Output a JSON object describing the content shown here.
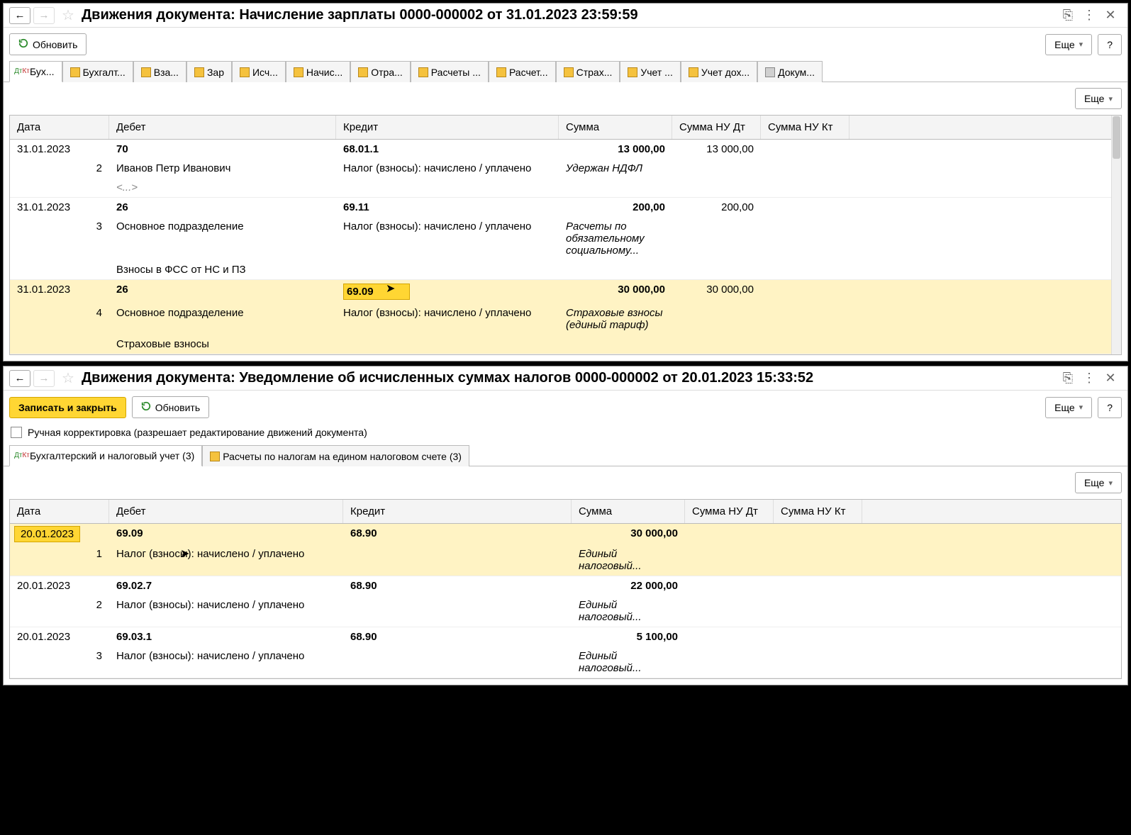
{
  "window1": {
    "title": "Движения документа: Начисление зарплаты 0000-000002 от 31.01.2023 23:59:59",
    "refresh": "Обновить",
    "more": "Еще",
    "help": "?",
    "tabs": [
      "Бух...",
      "Бухгалт...",
      "Вза...",
      "Зар",
      "Исч...",
      "Начис...",
      "Отра...",
      "Расчеты ...",
      "Расчет...",
      "Страх...",
      "Учет ...",
      "Учет дох...",
      "Докум..."
    ],
    "submore": "Еще",
    "headers": {
      "date": "Дата",
      "debit": "Дебет",
      "credit": "Кредит",
      "sum": "Сумма",
      "nudt": "Сумма НУ Дт",
      "nukt": "Сумма НУ Кт"
    },
    "rows": [
      {
        "date": "31.01.2023",
        "num": "2",
        "debit1": "70",
        "debit2": "Иванов Петр Иванович",
        "debit3": "<...>",
        "credit1": "68.01.1",
        "credit2": "Налог (взносы): начислено / уплачено",
        "sum": "13 000,00",
        "nudt": "13 000,00",
        "desc": "Удержан НДФЛ"
      },
      {
        "date": "31.01.2023",
        "num": "3",
        "debit1": "26",
        "debit2": "Основное подразделение",
        "debit3": "Взносы в ФСС от НС и ПЗ",
        "credit1": "69.11",
        "credit2": "Налог (взносы): начислено / уплачено",
        "sum": "200,00",
        "nudt": "200,00",
        "desc": "Расчеты по обязательному социальному..."
      },
      {
        "date": "31.01.2023",
        "num": "4",
        "debit1": "26",
        "debit2": "Основное подразделение",
        "debit3": "Страховые взносы",
        "credit1": "69.09",
        "credit2": "Налог (взносы): начислено / уплачено",
        "sum": "30 000,00",
        "nudt": "30 000,00",
        "desc": "Страховые взносы (единый тариф)",
        "highlight": true
      }
    ]
  },
  "window2": {
    "title": "Движения документа: Уведомление об исчисленных суммах налогов 0000-000002 от 20.01.2023 15:33:52",
    "saveclose": "Записать и закрыть",
    "refresh": "Обновить",
    "more": "Еще",
    "help": "?",
    "manual": "Ручная корректировка (разрешает редактирование движений документа)",
    "tabs": [
      "Бухгалтерский и налоговый учет (3)",
      "Расчеты по налогам на едином налоговом счете (3)"
    ],
    "submore": "Еще",
    "headers": {
      "date": "Дата",
      "debit": "Дебет",
      "credit": "Кредит",
      "sum": "Сумма",
      "nudt": "Сумма НУ Дт",
      "nukt": "Сумма НУ Кт"
    },
    "rows": [
      {
        "date": "20.01.2023",
        "num": "1",
        "debit1": "69.09",
        "debit2": "Налог (взносы): начислено / уплачено",
        "credit1": "68.90",
        "sum": "30 000,00",
        "desc": "Единый налоговый...",
        "highlight": true
      },
      {
        "date": "20.01.2023",
        "num": "2",
        "debit1": "69.02.7",
        "debit2": "Налог (взносы): начислено / уплачено",
        "credit1": "68.90",
        "sum": "22 000,00",
        "desc": "Единый налоговый..."
      },
      {
        "date": "20.01.2023",
        "num": "3",
        "debit1": "69.03.1",
        "debit2": "Налог (взносы): начислено / уплачено",
        "credit1": "68.90",
        "sum": "5 100,00",
        "desc": "Единый налоговый..."
      }
    ]
  }
}
